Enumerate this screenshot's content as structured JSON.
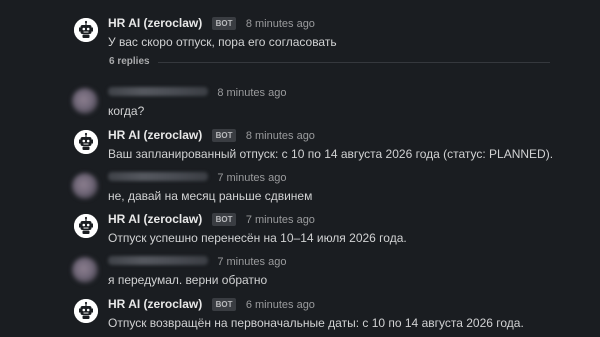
{
  "thread": {
    "replies_label": "6 replies",
    "bot_badge": "BOT",
    "messages": [
      {
        "author": "HR AI (zeroclaw)",
        "is_bot": true,
        "time": "8 minutes ago",
        "text": "У вас скоро отпуск, пора его согласовать"
      },
      {
        "author": "",
        "is_bot": false,
        "time": "8 minutes ago",
        "text": "когда?"
      },
      {
        "author": "HR AI (zeroclaw)",
        "is_bot": true,
        "time": "8 minutes ago",
        "text": "Ваш запланированный отпуск: с 10 по 14 августа 2026 года (статус: PLANNED)."
      },
      {
        "author": "",
        "is_bot": false,
        "time": "7 minutes ago",
        "text": "не, давай на месяц раньше сдвинем"
      },
      {
        "author": "HR AI (zeroclaw)",
        "is_bot": true,
        "time": "7 minutes ago",
        "text": "Отпуск успешно перенесён на 10–14 июля 2026 года."
      },
      {
        "author": "",
        "is_bot": false,
        "time": "7 minutes ago",
        "text": "я передумал. верни обратно"
      },
      {
        "author": "HR AI (zeroclaw)",
        "is_bot": true,
        "time": "6 minutes ago",
        "text": "Отпуск возвращён на первоначальные даты: с 10 по 14 августа 2026 года."
      }
    ]
  },
  "icons": {
    "bot_avatar": "robot-icon",
    "user_avatar": "blurred-avatar"
  }
}
